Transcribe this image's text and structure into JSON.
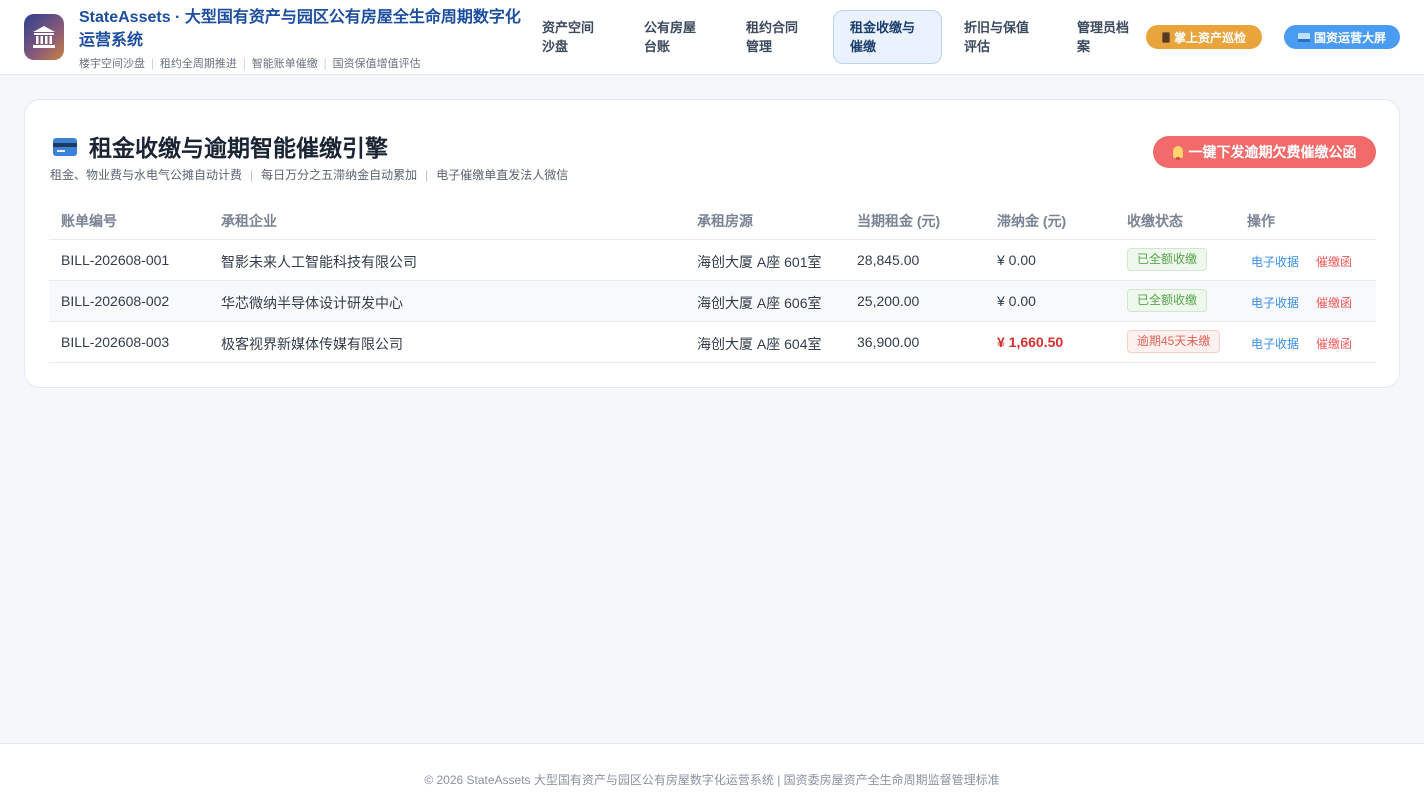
{
  "header": {
    "brand_title_main": "StateAssets · 大型国有资产与园区公有房屋全生命周期数字化",
    "brand_title_tail": "运营系统",
    "brand_tags": [
      "楼宇空间沙盘",
      "租约全周期推进",
      "智能账单催缴",
      "国资保值增值评估"
    ],
    "nav": [
      {
        "label": "资产空间沙盘",
        "active": false
      },
      {
        "label": "公有房屋台账",
        "active": false
      },
      {
        "label": "租约合同管理",
        "active": false
      },
      {
        "label": "租金收缴与催缴",
        "active": true
      },
      {
        "label": "折旧与保值评估",
        "active": false
      },
      {
        "label": "管理员档案",
        "active": false
      }
    ],
    "nav_lines": [
      [
        "资产空间",
        "沙盘"
      ],
      [
        "公有房屋",
        "台账"
      ],
      [
        "租约合同",
        "管理"
      ],
      [
        "租金收缴与",
        "催缴"
      ],
      [
        "折旧与保值",
        "评估"
      ],
      [
        "管理员档",
        "案"
      ]
    ],
    "mobile_button": "掌上资产巡检",
    "screen_button": "国资运营大屏"
  },
  "card": {
    "title": "租金收缴与逾期智能催缴引擎",
    "subtitle_items": [
      "租金、物业费与水电气公摊自动计费",
      "每日万分之五滞纳金自动累加",
      "电子催缴单直发法人微信"
    ],
    "urge_button": "一键下发逾期欠费催缴公函"
  },
  "table": {
    "headers": [
      "账单编号",
      "承租企业",
      "承租房源",
      "当期租金 (元)",
      "滞纳金 (元)",
      "收缴状态",
      "操作"
    ],
    "rows": [
      {
        "bill_no": "BILL-202608-001",
        "tenant": "智影未来人工智能科技有限公司",
        "unit": "海创大厦 A座 601室",
        "rent": "28,845.00",
        "late_fee": "¥ 0.00",
        "status": "已全额收缴",
        "status_type": "ok",
        "op_receipt": "电子收据",
        "op_notice": "催缴函"
      },
      {
        "bill_no": "BILL-202608-002",
        "tenant": "华芯微纳半导体设计研发中心",
        "unit": "海创大厦 A座 606室",
        "rent": "25,200.00",
        "late_fee": "¥ 0.00",
        "status": "已全额收缴",
        "status_type": "ok",
        "op_receipt": "电子收据",
        "op_notice": "催缴函"
      },
      {
        "bill_no": "BILL-202608-003",
        "tenant": "极客视界新媒体传媒有限公司",
        "unit": "海创大厦 A座 604室",
        "rent": "36,900.00",
        "late_fee": "¥ 1,660.50",
        "status": "逾期45天未缴",
        "status_type": "late",
        "op_receipt": "电子收据",
        "op_notice": "催缴函"
      }
    ]
  },
  "footer": {
    "text": "© 2026 StateAssets 大型国有资产与园区公有房屋数字化运营系统 | 国资委房屋资产全生命周期监督管理标准"
  },
  "colors": {
    "brand_blue": "#1d4e9e",
    "brand_gold": "#b07a2a",
    "accent_red": "#f26b6b",
    "pill_orange": "#e9a43c",
    "pill_blue": "#4a9cf2",
    "ok_green": "#58a34c",
    "late_red": "#d32f2f"
  },
  "icons": {
    "logo": "bank-building-icon",
    "mobile": "mobile-phone-icon",
    "screen": "monitor-icon",
    "card": "credit-card-icon",
    "urge": "bell-icon"
  }
}
